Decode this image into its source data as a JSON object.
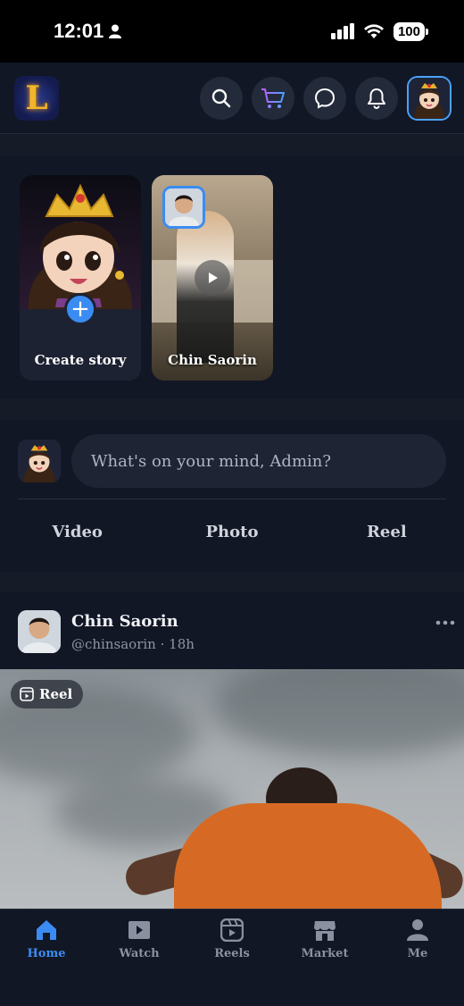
{
  "status_bar": {
    "time": "12:01",
    "battery": "100"
  },
  "header": {
    "logo_text": "L",
    "icons": [
      "search-icon",
      "cart-icon",
      "messenger-icon",
      "bell-icon",
      "avatar"
    ]
  },
  "stories": [
    {
      "label": "Create story",
      "type": "create"
    },
    {
      "label": "Chin Saorin",
      "type": "video"
    }
  ],
  "composer": {
    "placeholder": "What's on your mind, Admin?",
    "actions": [
      "Video",
      "Photo",
      "Reel"
    ]
  },
  "post": {
    "author": "Chin Saorin",
    "handle": "@chinsaorin",
    "separator": "·",
    "time": "18h",
    "badge": "Reel"
  },
  "bottom_nav": {
    "items": [
      {
        "label": "Home",
        "icon": "home-icon",
        "active": true
      },
      {
        "label": "Watch",
        "icon": "watch-icon",
        "active": false
      },
      {
        "label": "Reels",
        "icon": "reels-icon",
        "active": false
      },
      {
        "label": "Market",
        "icon": "market-icon",
        "active": false
      },
      {
        "label": "Me",
        "icon": "person-icon",
        "active": false
      }
    ]
  },
  "colors": {
    "accent": "#3b8cf2",
    "background": "#161b28",
    "surface": "#121725"
  }
}
